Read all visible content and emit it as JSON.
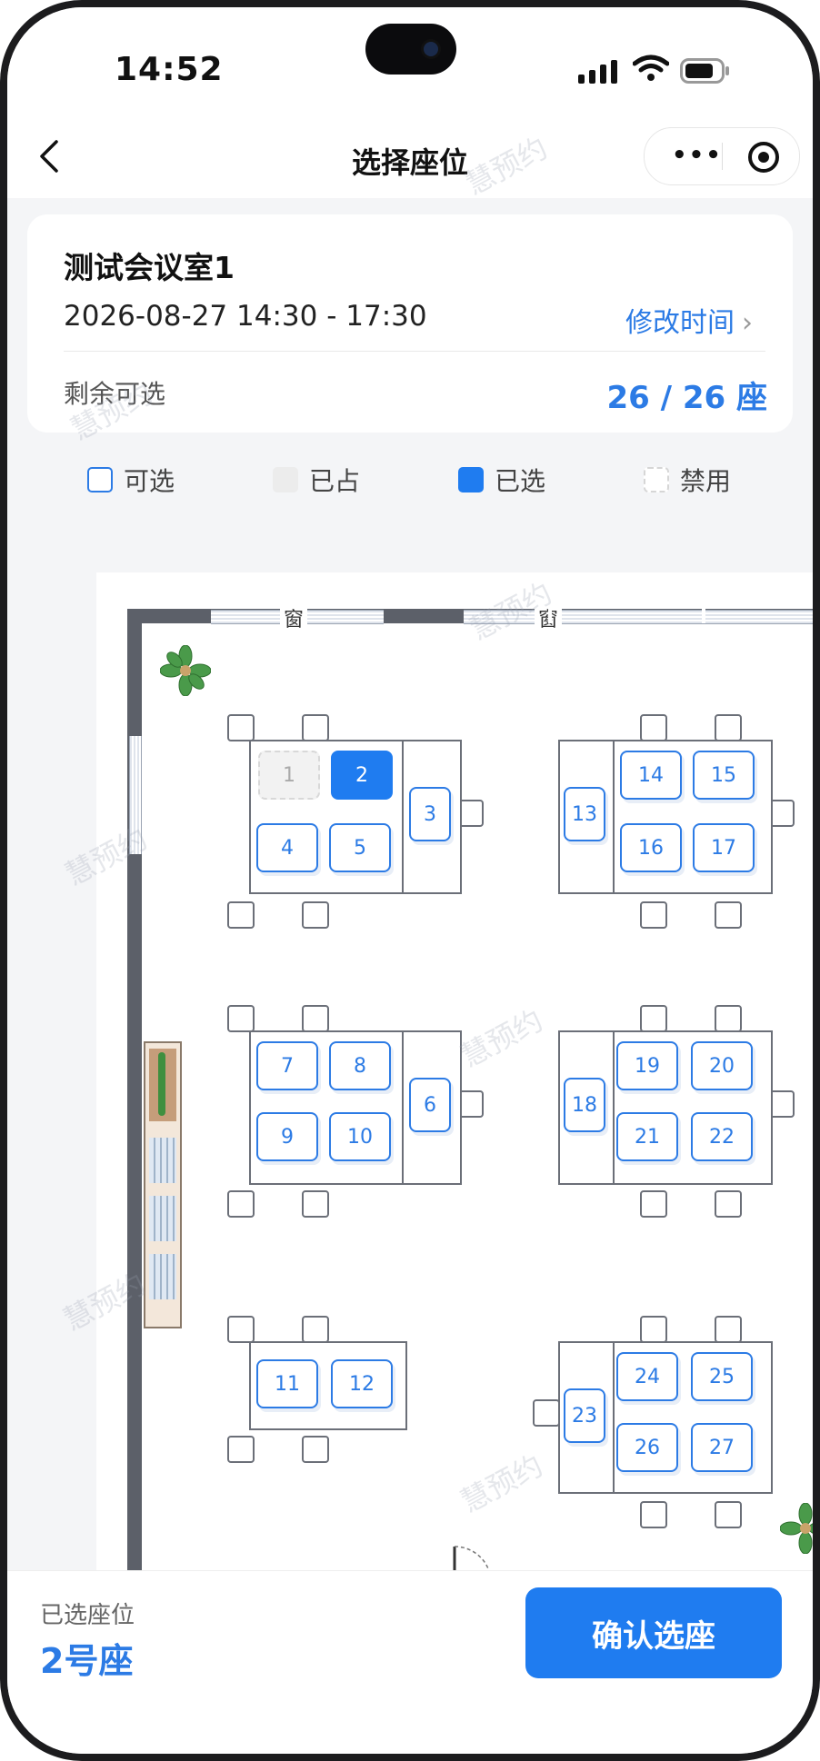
{
  "status": {
    "time": "14:52"
  },
  "nav": {
    "title": "选择座位"
  },
  "room": {
    "name": "测试会议室1",
    "datetime": "2026-08-27  14:30 - 17:30",
    "change_label": "修改时间",
    "remaining_label": "剩余可选",
    "remaining_value": "26 / 26 座"
  },
  "legend": {
    "available": "可选",
    "occupied": "已占",
    "selected": "已选",
    "disabled": "禁用"
  },
  "map": {
    "window_label": "窗",
    "seats": {
      "s1": "1",
      "s2": "2",
      "s3": "3",
      "s4": "4",
      "s5": "5",
      "s6": "6",
      "s7": "7",
      "s8": "8",
      "s9": "9",
      "s10": "10",
      "s11": "11",
      "s12": "12",
      "s13": "13",
      "s14": "14",
      "s15": "15",
      "s16": "16",
      "s17": "17",
      "s18": "18",
      "s19": "19",
      "s20": "20",
      "s21": "21",
      "s22": "22",
      "s23": "23",
      "s24": "24",
      "s25": "25",
      "s26": "26",
      "s27": "27"
    }
  },
  "watermark": "慧预约",
  "bottom": {
    "selected_label": "已选座位",
    "selected_value": "2号座",
    "confirm_label": "确认选座"
  },
  "colors": {
    "accent": "#1f7cf0",
    "text_blue": "#2c7be5"
  }
}
